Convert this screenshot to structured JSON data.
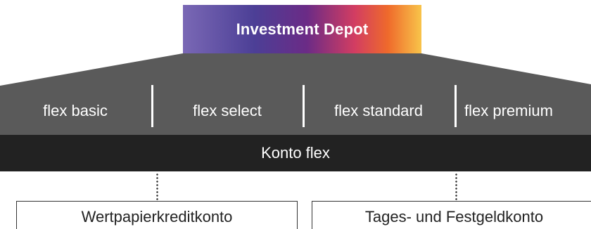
{
  "investment_depot": {
    "title": "Investment Depot"
  },
  "flex_options": [
    {
      "label": "flex basic"
    },
    {
      "label": "flex select"
    },
    {
      "label": "flex standard"
    },
    {
      "label": "flex premium"
    }
  ],
  "konto": {
    "label": "Konto flex"
  },
  "accounts": [
    {
      "label": "Wertpapierkreditkonto"
    },
    {
      "label": "Tages- und Festgeldkonto"
    }
  ],
  "colors": {
    "band": "#5a5a5a",
    "konto_bar": "#222222",
    "gradient": [
      "#7a68b5",
      "#4c3f96",
      "#6b2b86",
      "#d23d62",
      "#ef6a2b",
      "#f8c44a"
    ]
  }
}
